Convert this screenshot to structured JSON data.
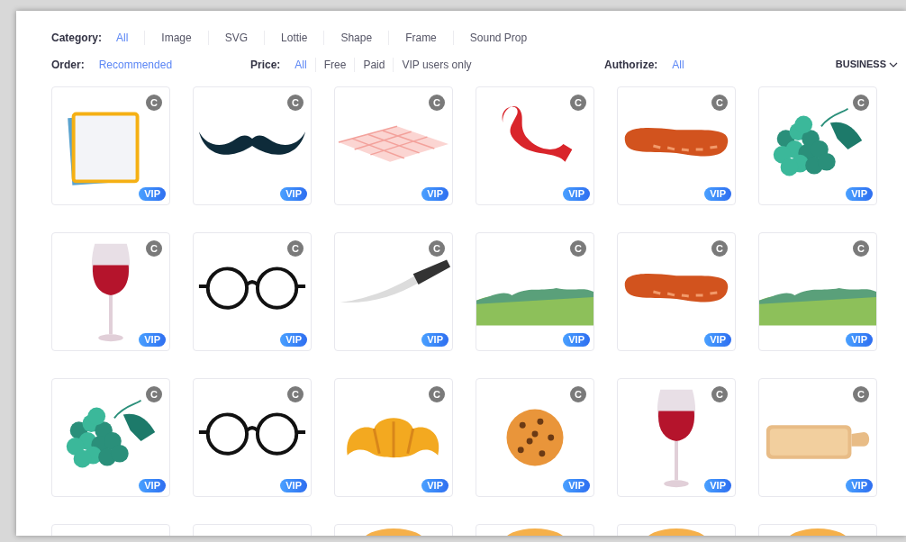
{
  "filters": {
    "category": {
      "label": "Category:",
      "options": [
        {
          "label": "All",
          "selected": true
        },
        {
          "label": "Image",
          "selected": false
        },
        {
          "label": "SVG",
          "selected": false
        },
        {
          "label": "Lottie",
          "selected": false
        },
        {
          "label": "Shape",
          "selected": false
        },
        {
          "label": "Frame",
          "selected": false
        },
        {
          "label": "Sound Prop",
          "selected": false
        }
      ]
    },
    "order": {
      "label": "Order:",
      "options": [
        {
          "label": "Recommended",
          "selected": true
        }
      ]
    },
    "price": {
      "label": "Price:",
      "options": [
        {
          "label": "All",
          "selected": true
        },
        {
          "label": "Free",
          "selected": false
        },
        {
          "label": "Paid",
          "selected": false
        },
        {
          "label": "VIP users only",
          "selected": false
        }
      ]
    },
    "authorize": {
      "label": "Authorize:",
      "options": [
        {
          "label": "All",
          "selected": true
        }
      ]
    },
    "license_dropdown": {
      "label": "BUSINESS"
    }
  },
  "assets": [
    {
      "kind": "frame",
      "copyright": "C",
      "badge": "VIP"
    },
    {
      "kind": "mustache",
      "copyright": "C",
      "badge": "VIP"
    },
    {
      "kind": "cloth",
      "copyright": "C",
      "badge": "VIP"
    },
    {
      "kind": "ribbon",
      "copyright": "C",
      "badge": "VIP"
    },
    {
      "kind": "sausage",
      "copyright": "C",
      "badge": "VIP"
    },
    {
      "kind": "grapes",
      "copyright": "C",
      "badge": "VIP"
    },
    {
      "kind": "wine",
      "copyright": "C",
      "badge": "VIP"
    },
    {
      "kind": "glasses",
      "copyright": "C",
      "badge": "VIP"
    },
    {
      "kind": "knife",
      "copyright": "C",
      "badge": "VIP"
    },
    {
      "kind": "grass",
      "copyright": "C",
      "badge": "VIP"
    },
    {
      "kind": "sausage",
      "copyright": "C",
      "badge": "VIP"
    },
    {
      "kind": "grass",
      "copyright": "C",
      "badge": "VIP"
    },
    {
      "kind": "grapes",
      "copyright": "C",
      "badge": "VIP"
    },
    {
      "kind": "glasses",
      "copyright": "C",
      "badge": "VIP"
    },
    {
      "kind": "croissant",
      "copyright": "C",
      "badge": "VIP"
    },
    {
      "kind": "cookie",
      "copyright": "C",
      "badge": "VIP"
    },
    {
      "kind": "wine",
      "copyright": "C",
      "badge": "VIP"
    },
    {
      "kind": "board",
      "copyright": "C",
      "badge": "VIP"
    },
    {
      "kind": "blank"
    },
    {
      "kind": "blank"
    },
    {
      "kind": "dome"
    },
    {
      "kind": "dome"
    },
    {
      "kind": "dome"
    },
    {
      "kind": "dome"
    }
  ]
}
